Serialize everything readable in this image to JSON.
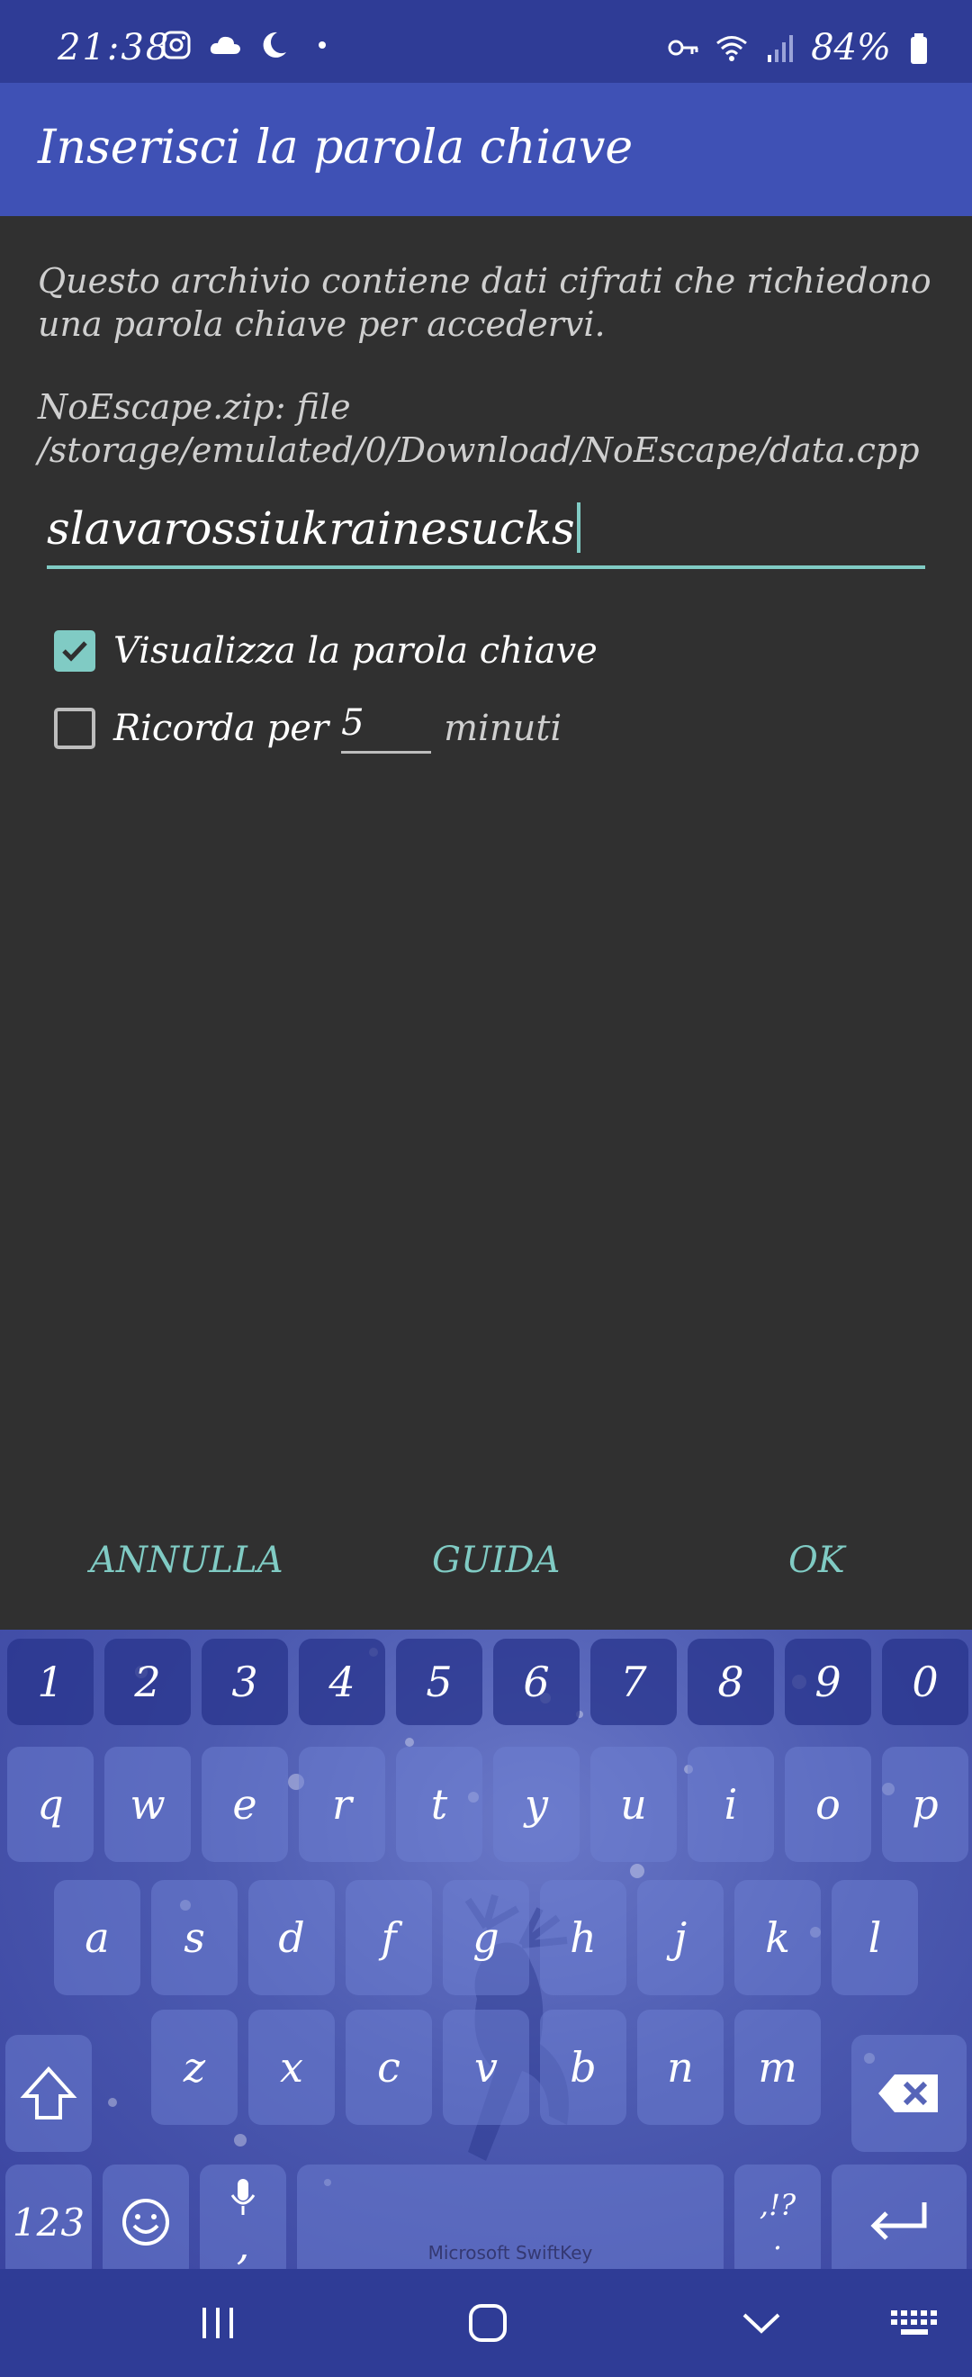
{
  "status_bar": {
    "time": "21:38",
    "battery": "84%",
    "left_icons": [
      "instagram-icon",
      "cloud-icon",
      "moon-icon",
      "dot-icon"
    ],
    "right_icons": [
      "vpn-key-icon",
      "wifi-icon",
      "signal-icon",
      "battery-icon"
    ]
  },
  "dialog": {
    "title": "Inserisci la parola chiave",
    "message": "Questo archivio contiene dati cifrati che richiedono una parola chiave per accedervi.",
    "file_path": "NoEscape.zip: file /storage/emulated/0/Download/NoEscape/data.cpp",
    "password_value": "slavarossiukrainesucks",
    "show_password_label": "Visualizza la parola chiave",
    "show_password_checked": true,
    "remember_label": "Ricorda per",
    "remember_checked": false,
    "remember_minutes": "5",
    "minutes_label": "minuti",
    "buttons": {
      "cancel": "ANNULLA",
      "help": "GUIDA",
      "ok": "OK"
    }
  },
  "keyboard": {
    "brand": "Microsoft SwiftKey",
    "number_row": [
      "1",
      "2",
      "3",
      "4",
      "5",
      "6",
      "7",
      "8",
      "9",
      "0"
    ],
    "row1": [
      "q",
      "w",
      "e",
      "r",
      "t",
      "y",
      "u",
      "i",
      "o",
      "p"
    ],
    "row2": [
      "a",
      "s",
      "d",
      "f",
      "g",
      "h",
      "j",
      "k",
      "l"
    ],
    "row3": [
      "z",
      "x",
      "c",
      "v",
      "b",
      "n",
      "m"
    ],
    "symbols_key": "123",
    "punct_top": ",!?",
    "punct_bottom": ".",
    "comma": ","
  },
  "colors": {
    "status_bar": "#2f3c96",
    "app_bar": "#3f51b5",
    "background": "#303030",
    "accent": "#80cbc4"
  }
}
